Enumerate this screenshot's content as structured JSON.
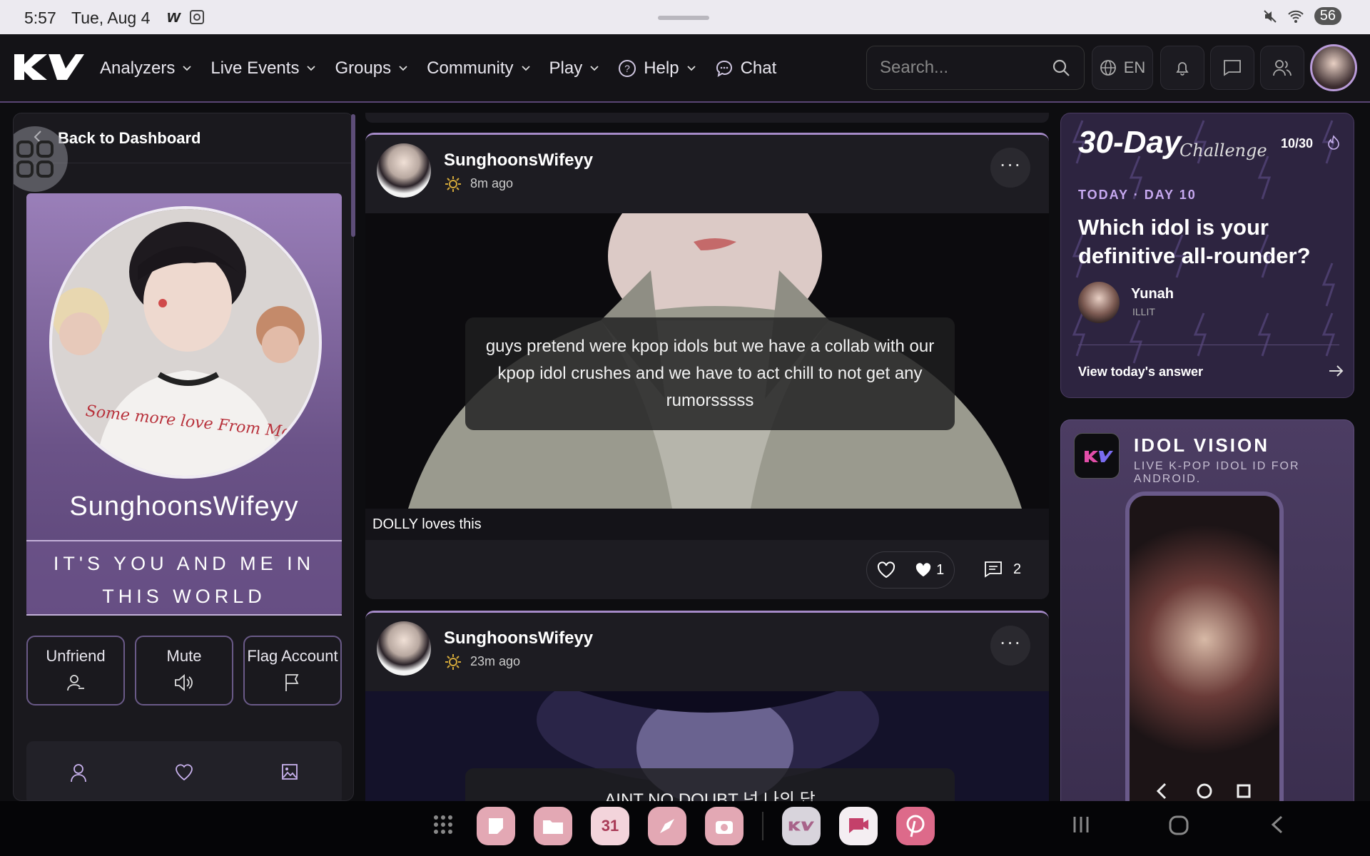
{
  "statusbar": {
    "time": "5:57",
    "date": "Tue, Aug 4",
    "battery": "56"
  },
  "nav": {
    "logo_text": "KV",
    "items": [
      {
        "label": "Analyzers",
        "dropdown": true
      },
      {
        "label": "Live Events",
        "dropdown": true
      },
      {
        "label": "Groups",
        "dropdown": true
      },
      {
        "label": "Community",
        "dropdown": true
      },
      {
        "label": "Play",
        "dropdown": true
      },
      {
        "label": "Help",
        "dropdown": true,
        "icon": "help-circle-icon"
      },
      {
        "label": "Chat",
        "dropdown": false,
        "icon": "chat-bubble-icon"
      }
    ],
    "search_placeholder": "Search...",
    "language": "EN"
  },
  "left": {
    "back_label": "Back to Dashboard",
    "profile_name": "SunghoonsWifeyy",
    "bio": "IT'S YOU AND ME IN THIS WORLD",
    "shirt_text": "Some more love From Me",
    "actions": [
      {
        "label": "Unfriend",
        "icon": "remove-user-icon"
      },
      {
        "label": "Mute",
        "icon": "speaker-icon"
      },
      {
        "label": "Flag Account",
        "icon": "flag-icon"
      }
    ],
    "tabs": [
      {
        "icon": "user-icon"
      },
      {
        "icon": "heart-icon"
      },
      {
        "icon": "image-icon"
      }
    ]
  },
  "posts": [
    {
      "author": "SunghoonsWifeyy",
      "time": "8m ago",
      "caption": "guys pretend were kpop idols but we have a collab with our kpop idol crushes and we have to act chill to not get any rumorsssss",
      "loves": "DOLLY loves this",
      "like_count": "1",
      "comment_count": "2"
    },
    {
      "author": "SunghoonsWifeyy",
      "time": "23m ago",
      "caption": "AINT NO DOUBT 넌 나의 답"
    }
  ],
  "challenge": {
    "title": "30-Day",
    "subtitle": "Challenge",
    "count": "10/30",
    "today": "TODAY · DAY 10",
    "question": "Which idol is your definitive all-rounder?",
    "answer_name": "Yunah",
    "answer_group": "ILLIT",
    "view_label": "View today's answer"
  },
  "promo": {
    "title": "IDOL VISION",
    "subtitle": "LIVE K-POP IDOL ID FOR ANDROID."
  },
  "dock": {
    "calendar_day": "31"
  },
  "colors": {
    "accent": "#a58ac8",
    "nav_bg": "#141317",
    "panel": "#1a191e",
    "profile": "#8a6fab"
  }
}
